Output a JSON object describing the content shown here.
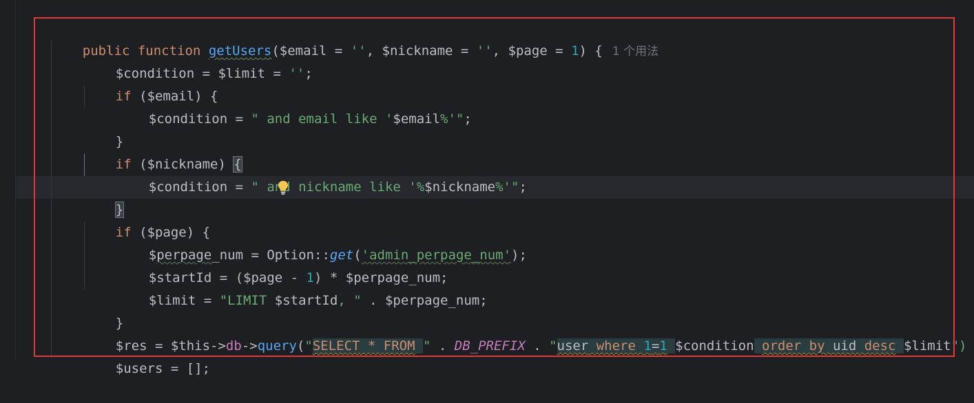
{
  "editor": {
    "inlay_hint": "1 个用法",
    "lines": {
      "l1": {
        "public": "public",
        "function": "function",
        "name": "getUsers",
        "p1": "($email = ",
        "s1": "''",
        "p2": ", $nickname = ",
        "s2": "''",
        "p3": ", $page = ",
        "n1": "1",
        "p4": ") {"
      },
      "l2": {
        "a": "$condition = $limit = ",
        "s": "''",
        "b": ";"
      },
      "l3": {
        "kw": "if",
        "a": " ($email) {"
      },
      "l4": {
        "a": "$condition = ",
        "s1": "\" and email like '",
        "v": "$email",
        "s2": "%'\"",
        "b": ";"
      },
      "l5": {
        "a": "}"
      },
      "l6": {
        "kw": "if",
        "a": " ($nickname) ",
        "brace": "{"
      },
      "l7": {
        "a": "$condition = ",
        "s1": "\" and nickname like '%",
        "v": "$nickname",
        "s2": "%'\"",
        "b": ";"
      },
      "l8": {
        "brace": "}"
      },
      "l9": {
        "kw": "if",
        "a": " ($page) {"
      },
      "l10": {
        "a1": "$",
        "a2": "perpage",
        "a3": "_num = Option::",
        "fn": "get",
        "b": "(",
        "s": "'admin_perpage_num'",
        "c": ");"
      },
      "l11": {
        "a": "$startId = ($page - ",
        "n": "1",
        "b": ") * $perpage_num;"
      },
      "l12": {
        "a": "$limit = ",
        "s1": "\"LIMIT ",
        "v": "$startId",
        "s2": ", \"",
        "b": " . $perpage_num;"
      },
      "l13": {
        "a": "}"
      },
      "l14": {
        "a": "$res = $this->",
        "db": "db",
        "arrow": "->",
        "fn": "query",
        "p": "(",
        "q1": "\"",
        "sel": "SELECT",
        "star": " * ",
        "from": "FROM",
        "sp": " ",
        "q2": "\"",
        "dot1": " . ",
        "const": "DB_PREFIX",
        "dot2": " . ",
        "q3": "\"",
        "user": "user",
        "where": " where ",
        "one1": "1",
        "eq": "=",
        "one2": "1",
        "sp2": " ",
        "cond": "$condition",
        "sp3": " ",
        "order": "order by",
        "uid": " uid ",
        "desc": "desc",
        "sp4": " ",
        "lim": "$limit",
        "q4": "\")"
      },
      "l15": {
        "a": "$users = [];"
      }
    }
  },
  "colors": {
    "background": "#1e1f22",
    "keyword": "#cf8e6d",
    "function": "#56a8f5",
    "string": "#6aab73",
    "number": "#2aacb8",
    "constant": "#c77dbb",
    "highlight_box": "#e53935"
  },
  "icons": {
    "intention_bulb": "lightbulb-icon"
  }
}
